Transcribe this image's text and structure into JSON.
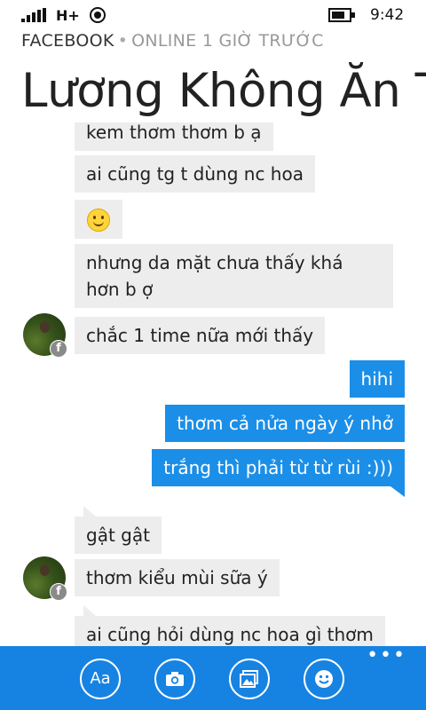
{
  "status_bar": {
    "network": "H+",
    "time": "9:42"
  },
  "header": {
    "app_name": "FACEBOOK",
    "separator": "•",
    "presence": "ONLINE 1 GIỜ TRƯỚC",
    "contact_name": "Lương Không Ăn T"
  },
  "messages": [
    {
      "from": "them",
      "text": "kem thơm thơm b ạ"
    },
    {
      "from": "them",
      "text": "ai cũng tg t dùng nc hoa"
    },
    {
      "from": "them",
      "emoji": "smiley"
    },
    {
      "from": "them",
      "text": "nhưng da mặt chưa thấy khá hơn b ợ"
    },
    {
      "from": "them",
      "text": "chắc 1 time nữa mới thấy"
    },
    {
      "from": "me",
      "text": "hihi"
    },
    {
      "from": "me",
      "text": "thơm cả nửa ngày ý nhở"
    },
    {
      "from": "me",
      "text": "trắng thì phải từ từ rùi :)))"
    },
    {
      "from": "them",
      "text": "gật gật"
    },
    {
      "from": "them",
      "text": "thơm kiểu mùi sữa ý"
    },
    {
      "from": "them",
      "text": "ai cũng hỏi dùng nc hoa gì thơm"
    }
  ],
  "app_bar": {
    "text_button_label": "Aa",
    "more_label": "•••",
    "icons": [
      "font-icon",
      "camera-icon",
      "photo-icon",
      "smiley-icon"
    ]
  },
  "colors": {
    "outgoing": "#1b8fe8",
    "incoming": "#ededed",
    "app_bar": "#1683e3"
  }
}
